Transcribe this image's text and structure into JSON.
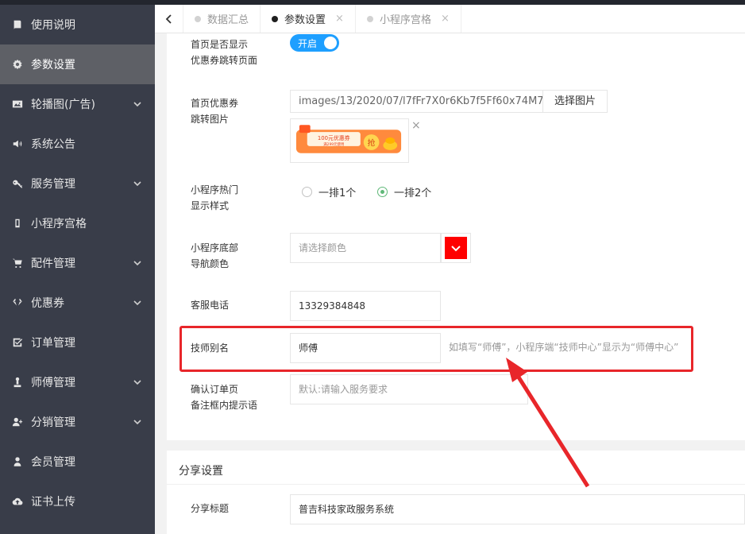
{
  "sidebar": {
    "items": [
      {
        "label": "使用说明",
        "icon": "book-icon",
        "expandable": false,
        "active": false
      },
      {
        "label": "参数设置",
        "icon": "gear-icon",
        "expandable": false,
        "active": true
      },
      {
        "label": "轮播图(广告)",
        "icon": "image-icon",
        "expandable": true,
        "active": false
      },
      {
        "label": "系统公告",
        "icon": "speaker-icon",
        "expandable": false,
        "active": false
      },
      {
        "label": "服务管理",
        "icon": "key-icon",
        "expandable": true,
        "active": false
      },
      {
        "label": "小程序宫格",
        "icon": "mobile-icon",
        "expandable": false,
        "active": false
      },
      {
        "label": "配件管理",
        "icon": "cart-icon",
        "expandable": true,
        "active": false
      },
      {
        "label": "优惠券",
        "icon": "diamond-icon",
        "expandable": true,
        "active": false
      },
      {
        "label": "订单管理",
        "icon": "checkbox-icon",
        "expandable": false,
        "active": false
      },
      {
        "label": "师傅管理",
        "icon": "worker-icon",
        "expandable": true,
        "active": false
      },
      {
        "label": "分销管理",
        "icon": "user-plus-icon",
        "expandable": true,
        "active": false
      },
      {
        "label": "会员管理",
        "icon": "user-icon",
        "expandable": false,
        "active": false
      },
      {
        "label": "证书上传",
        "icon": "cloud-upload-icon",
        "expandable": false,
        "active": false
      }
    ]
  },
  "tabs": [
    {
      "label": "数据汇总",
      "active": false,
      "closable": false
    },
    {
      "label": "参数设置",
      "active": true,
      "closable": true
    },
    {
      "label": "小程序宫格",
      "active": false,
      "closable": true
    }
  ],
  "form": {
    "coupon_jump": {
      "label_line1": "首页是否显示",
      "label_line2": "优惠券跳转页面",
      "switch_text": "开启"
    },
    "coupon_image": {
      "label_line1": "首页优惠券",
      "label_line2": "跳转图片",
      "path": "images/13/2020/07/l7fFr7X0r6Kb7f5Ff60x74M7",
      "pick_label": "选择图片",
      "remove_symbol": "×",
      "banner_text": "100元优惠券",
      "banner_sub": "满299元使用",
      "banner_badge": "抢"
    },
    "hot_style": {
      "label_line1": "小程序热门",
      "label_line2": "显示样式",
      "option1": "一排1个",
      "option2": "一排2个",
      "selected": 2
    },
    "nav_color": {
      "label_line1": "小程序底部",
      "label_line2": "导航颜色",
      "placeholder": "请选择颜色",
      "color": "#ff0000"
    },
    "phone": {
      "label": "客服电话",
      "value": "13329384848"
    },
    "alias": {
      "label": "技师别名",
      "value": "师傅",
      "hint": "如填写“师傅”，小程序端“技师中心”显示为“师傅中心”"
    },
    "remark": {
      "label_line1": "确认订单页",
      "label_line2": "备注框内提示语",
      "placeholder": "默认:请输入服务要求"
    }
  },
  "share": {
    "section_title": "分享设置",
    "title_label": "分享标题",
    "title_value": "普吉科技家政服务系统"
  },
  "colors": {
    "sidebar_bg": "#393d49",
    "sidebar_active": "#5e6066",
    "switch_blue": "#1e9fff",
    "radio_green": "#5fb878",
    "highlight_red": "#e8262a"
  }
}
